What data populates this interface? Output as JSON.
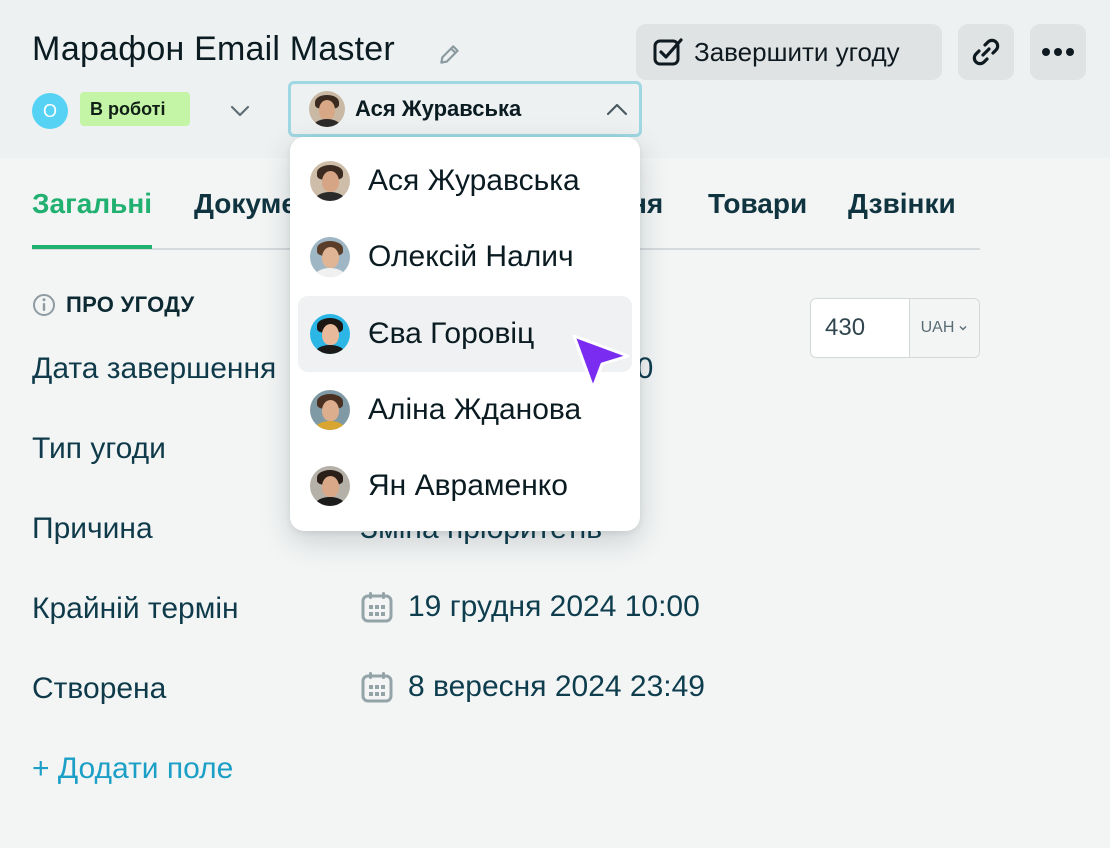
{
  "header": {
    "title": "Марафон Email Master",
    "complete_label": "Завершити угоду",
    "stage_initial": "О",
    "status": "В роботі",
    "assignee": "Ася Журавська"
  },
  "tabs": [
    {
      "label": "Загальні",
      "active": true
    },
    {
      "label": "Докуме"
    },
    {
      "label": "ня"
    },
    {
      "label": "Товари"
    },
    {
      "label": "Дзвінки"
    }
  ],
  "section": {
    "title": "ПРО УГОДУ",
    "amount": "430",
    "currency": "UAH"
  },
  "fields": [
    {
      "label": "Дата завершення",
      "value": "00"
    },
    {
      "label": "Тип угоди",
      "value": ""
    },
    {
      "label": "Причина",
      "value": "Зміна пріоритетів"
    },
    {
      "label": "Крайній термін",
      "value": "19 грудня 2024 10:00"
    },
    {
      "label": "Створена",
      "value": "8 вересня 2024 23:49"
    }
  ],
  "add_field": "+ Додати поле",
  "dropdown": {
    "options": [
      {
        "name": "Ася Журавська"
      },
      {
        "name": "Олексій Налич"
      },
      {
        "name": "Єва Горовіц",
        "hovered": true
      },
      {
        "name": "Аліна Жданова"
      },
      {
        "name": "Ян Авраменко"
      }
    ]
  },
  "colors": {
    "accent_green": "#20b070",
    "status_badge": "#c4f4a5",
    "link_blue": "#1b9fc6",
    "cursor_purple": "#7a2cf0"
  }
}
